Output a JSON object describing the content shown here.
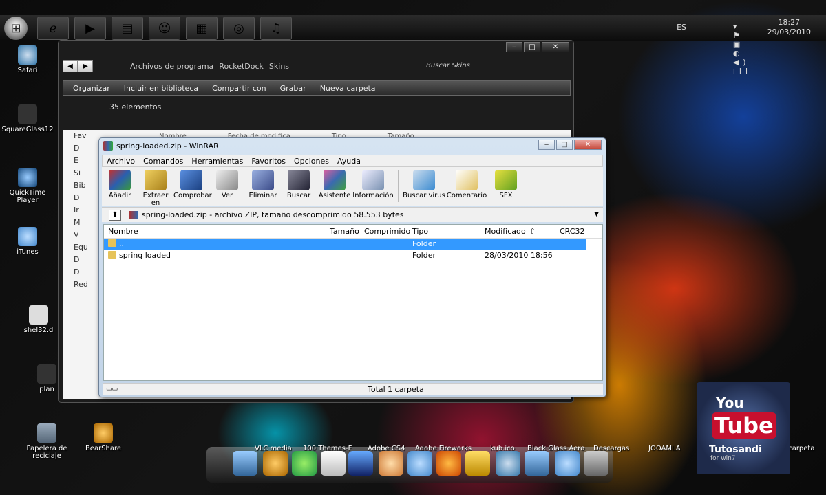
{
  "taskbar": {
    "language": "ES",
    "time": "18:27",
    "date": "29/03/2010",
    "pinned": [
      "ie-icon",
      "media-player-icon",
      "explorer-icon",
      "messenger-icon",
      "winrar-icon",
      "safari-icon",
      "itunes-icon"
    ]
  },
  "desktop_icons": [
    {
      "label": "Safari"
    },
    {
      "label": "SquareGlass12"
    },
    {
      "label": "QuickTime Player"
    },
    {
      "label": "iTunes"
    },
    {
      "label": "shel32.d"
    },
    {
      "label": "plan"
    },
    {
      "label": "Papelera de reciclaje"
    },
    {
      "label": "BearShare"
    }
  ],
  "explorer": {
    "breadcrumbs": [
      "Archivos de programa",
      "RocketDock",
      "Skins"
    ],
    "search_placeholder": "Buscar Skins",
    "toolbar": [
      "Organizar",
      "Incluir en biblioteca",
      "Compartir con",
      "Grabar",
      "Nueva carpeta"
    ],
    "item_count": "35 elementos",
    "columns": [
      "Nombre",
      "Fecha de modifica",
      "Tipo",
      "Tamaño"
    ],
    "sidebar": [
      "Fav",
      "D",
      "E",
      "Si",
      "Bib",
      "D",
      "Ir",
      "M",
      "V",
      "Equ",
      "D",
      "D",
      "Red"
    ]
  },
  "winrar": {
    "title": "spring-loaded.zip - WinRAR",
    "menu": [
      "Archivo",
      "Comandos",
      "Herramientas",
      "Favoritos",
      "Opciones",
      "Ayuda"
    ],
    "tools": [
      {
        "label": "Añadir",
        "color": "#c8302a"
      },
      {
        "label": "Extraer en",
        "color": "#d8b030"
      },
      {
        "label": "Comprobar",
        "color": "#2a5fb0"
      },
      {
        "label": "Ver",
        "color": "#9aa0a8"
      },
      {
        "label": "Eliminar",
        "color": "#6a7ab8"
      },
      {
        "label": "Buscar",
        "color": "#55606a"
      },
      {
        "label": "Asistente",
        "color": "#c83a8a"
      },
      {
        "label": "Información",
        "color": "#3a6ab0"
      }
    ],
    "tools2": [
      {
        "label": "Buscar virus",
        "color": "#3a8ad0"
      },
      {
        "label": "Comentario",
        "color": "#e0c060"
      },
      {
        "label": "SFX",
        "color": "#a8c030"
      }
    ],
    "path": "spring-loaded.zip - archivo ZIP, tamaño descomprimido 58.553 bytes",
    "columns": [
      "Nombre",
      "Tamaño",
      "Comprimido",
      "Tipo",
      "Modificado",
      "CRC32"
    ],
    "rows": [
      {
        "name": "..",
        "type": "Folder",
        "modified": ""
      },
      {
        "name": "spring loaded",
        "type": "Folder",
        "modified": "28/03/2010 18:56"
      }
    ],
    "status": "Total 1 carpeta"
  },
  "dock": {
    "labels": [
      "VLC media",
      "100 Themes-F",
      "Adobe CS4",
      "Adobe Fireworks",
      "kub.ico",
      "Black Glass Aero",
      "Descargas",
      "JOOAMLA",
      "Nueva carpeta"
    ]
  },
  "youtube_badge": {
    "you": "You",
    "tube": "Tube",
    "channel": "Tutosandi",
    "subtitle": "for win7"
  }
}
